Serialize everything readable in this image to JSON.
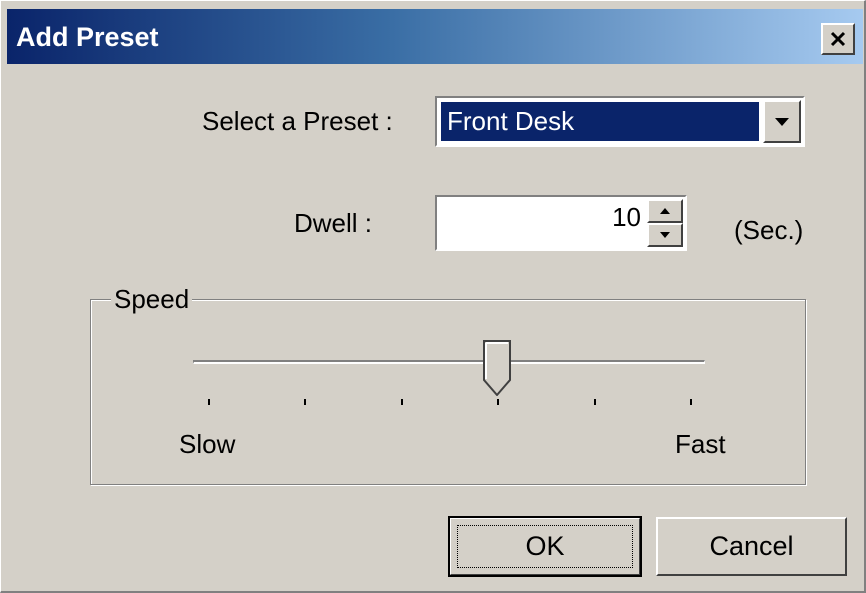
{
  "window": {
    "title": "Add Preset",
    "close_icon": "close-icon"
  },
  "preset": {
    "label": "Select a Preset :",
    "selected": "Front Desk",
    "dropdown_icon": "chevron-down-icon"
  },
  "dwell": {
    "label": "Dwell :",
    "value": "10",
    "unit": "(Sec.)",
    "up_icon": "spin-up-icon",
    "down_icon": "spin-down-icon"
  },
  "speed": {
    "group_label": "Speed",
    "min_label": "Slow",
    "max_label": "Fast",
    "tick_count": 6,
    "position": 0.6
  },
  "buttons": {
    "ok": "OK",
    "cancel": "Cancel"
  },
  "colors": {
    "face": "#d4d0c8",
    "title_start": "#0a246a",
    "title_end": "#a6caf0",
    "selection": "#0a246a"
  }
}
